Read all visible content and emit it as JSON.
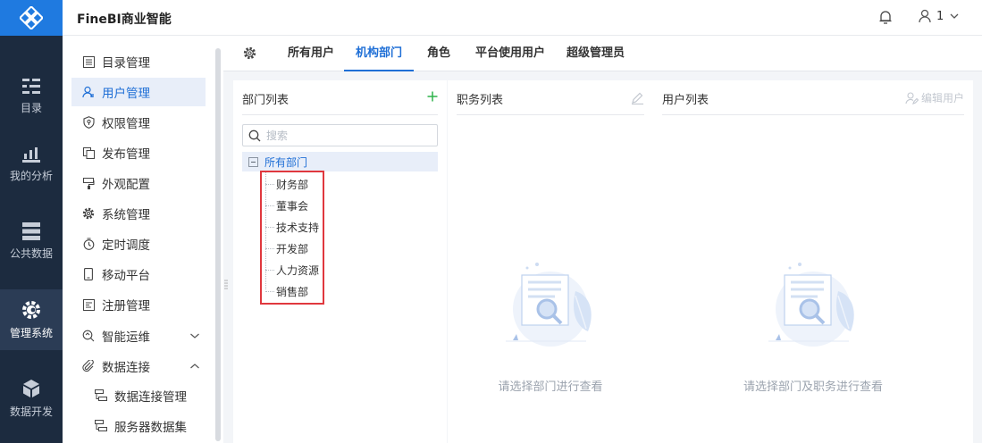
{
  "app": {
    "title": "FineBI商业智能"
  },
  "header": {
    "user": "1"
  },
  "rail": {
    "items": [
      {
        "label": "目录",
        "icon": "catalog-icon"
      },
      {
        "label": "我的分析",
        "icon": "chart-icon"
      },
      {
        "label": "公共数据",
        "icon": "database-icon"
      },
      {
        "label": "管理系统",
        "icon": "manage-gear-icon",
        "active": true
      },
      {
        "label": "数据开发",
        "icon": "cube-icon"
      }
    ]
  },
  "sidebar": {
    "items": [
      {
        "label": "目录管理",
        "icon": "list-icon"
      },
      {
        "label": "用户管理",
        "icon": "user-icon",
        "active": true
      },
      {
        "label": "权限管理",
        "icon": "shield-icon"
      },
      {
        "label": "发布管理",
        "icon": "copy-icon"
      },
      {
        "label": "外观配置",
        "icon": "brush-icon"
      },
      {
        "label": "系统管理",
        "icon": "gear-icon"
      },
      {
        "label": "定时调度",
        "icon": "timer-icon"
      },
      {
        "label": "移动平台",
        "icon": "phone-icon"
      },
      {
        "label": "注册管理",
        "icon": "register-icon"
      },
      {
        "label": "智能运维",
        "icon": "ops-icon"
      },
      {
        "label": "数据连接",
        "icon": "link-icon"
      }
    ],
    "subitems": [
      {
        "label": "数据连接管理",
        "icon": "connection-icon"
      },
      {
        "label": "服务器数据集",
        "icon": "dataset-icon"
      }
    ]
  },
  "tabs": [
    {
      "label": "所有用户"
    },
    {
      "label": "机构部门",
      "active": true
    },
    {
      "label": "角色"
    },
    {
      "label": "平台使用用户"
    },
    {
      "label": "超级管理员"
    }
  ],
  "dept_panel": {
    "title": "部门列表",
    "search_placeholder": "搜索",
    "root": "所有部门",
    "departments": [
      "财务部",
      "董事会",
      "技术支持",
      "开发部",
      "人力资源",
      "销售部"
    ]
  },
  "post_panel": {
    "title": "职务列表",
    "empty_text": "请选择部门进行查看"
  },
  "user_panel": {
    "title": "用户列表",
    "edit_label": "编辑用户",
    "empty_text": "请选择部门及职务进行查看"
  },
  "colors": {
    "accent": "#1f6fd6",
    "rail_bg": "#1c2b3f",
    "logo_bg": "#1f7ae0",
    "highlight": "#e0383e",
    "add": "#2fb34b"
  }
}
